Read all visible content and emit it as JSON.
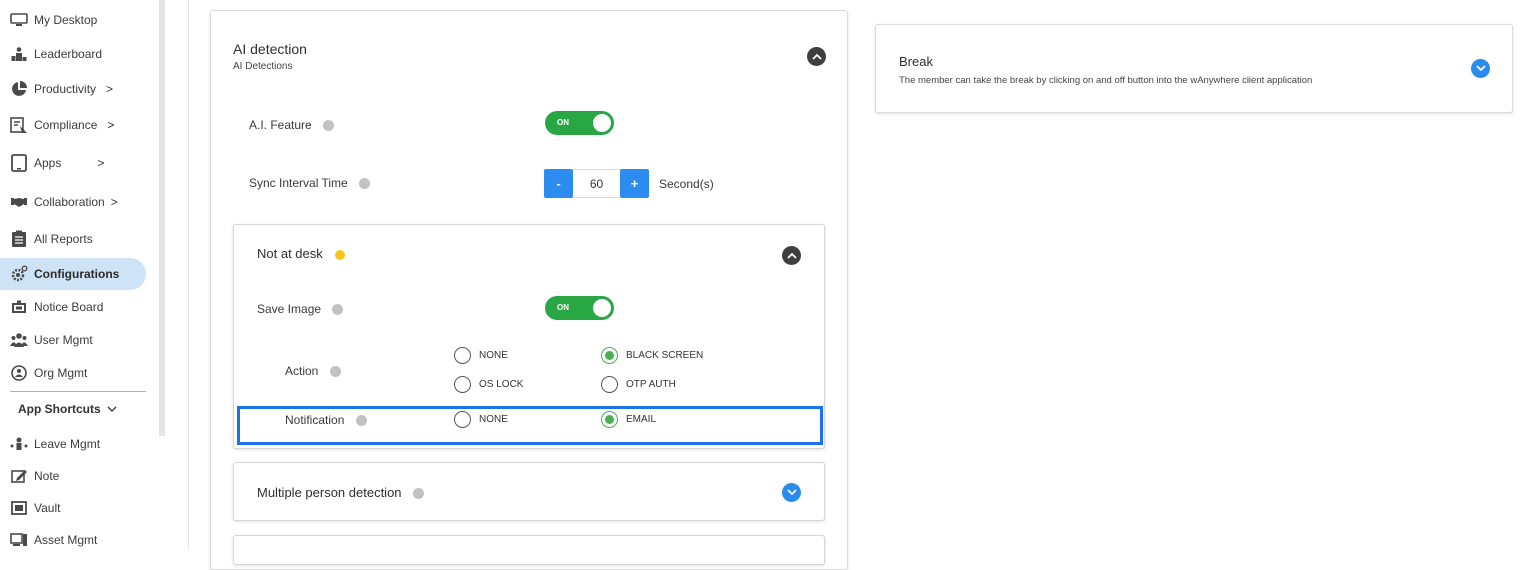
{
  "sidebar": {
    "items": [
      {
        "label": "My Desktop",
        "icon": "monitor-icon"
      },
      {
        "label": "Leaderboard",
        "icon": "podium-icon"
      },
      {
        "label": "Productivity",
        "icon": "pie-chart-icon",
        "chevron": ">"
      },
      {
        "label": "Compliance",
        "icon": "compliance-icon",
        "chevron": ">"
      },
      {
        "label": "Apps",
        "icon": "tablet-icon",
        "chevron": ">"
      },
      {
        "label": "Collaboration",
        "icon": "handshake-icon",
        "chevron": ">"
      },
      {
        "label": "All Reports",
        "icon": "clipboard-icon"
      },
      {
        "label": "Configurations",
        "icon": "gear-icon",
        "active": true
      },
      {
        "label": "Notice Board",
        "icon": "notice-board-icon"
      },
      {
        "label": "User Mgmt",
        "icon": "users-icon"
      },
      {
        "label": "Org Mgmt",
        "icon": "org-icon"
      }
    ],
    "shortcuts_title": "App Shortcuts",
    "shortcuts": [
      {
        "label": "Leave Mgmt",
        "icon": "leave-icon"
      },
      {
        "label": "Note",
        "icon": "note-icon"
      },
      {
        "label": "Vault",
        "icon": "vault-icon"
      },
      {
        "label": "Asset Mgmt",
        "icon": "asset-icon"
      }
    ]
  },
  "ai_card": {
    "title": "AI detection",
    "subtitle": "AI Detections",
    "ai_feature_label": "A.I. Feature",
    "ai_feature_state": "ON",
    "sync_label": "Sync Interval Time",
    "sync_minus": "-",
    "sync_value": "60",
    "sync_plus": "+",
    "sync_unit": "Second(s)"
  },
  "not_at_desk": {
    "title": "Not at desk",
    "save_image_label": "Save Image",
    "save_image_state": "ON",
    "action_label": "Action",
    "action_options": [
      "NONE",
      "BLACK SCREEN",
      "OS LOCK",
      "OTP AUTH"
    ],
    "action_selected": "BLACK SCREEN",
    "notification_label": "Notification",
    "notification_options": [
      "NONE",
      "EMAIL"
    ],
    "notification_selected": "EMAIL"
  },
  "multi_person": {
    "title": "Multiple person detection"
  },
  "break_card": {
    "title": "Break",
    "description": "The member can take the break by clicking on and off button into the wAnywhere client application"
  },
  "colors": {
    "toggle_on": "#29a745",
    "accent_blue": "#2d8cf0",
    "active_nav_bg": "#cfe3f7",
    "radio_checked": "#4caf50",
    "highlight_border": "#1a73e8"
  }
}
